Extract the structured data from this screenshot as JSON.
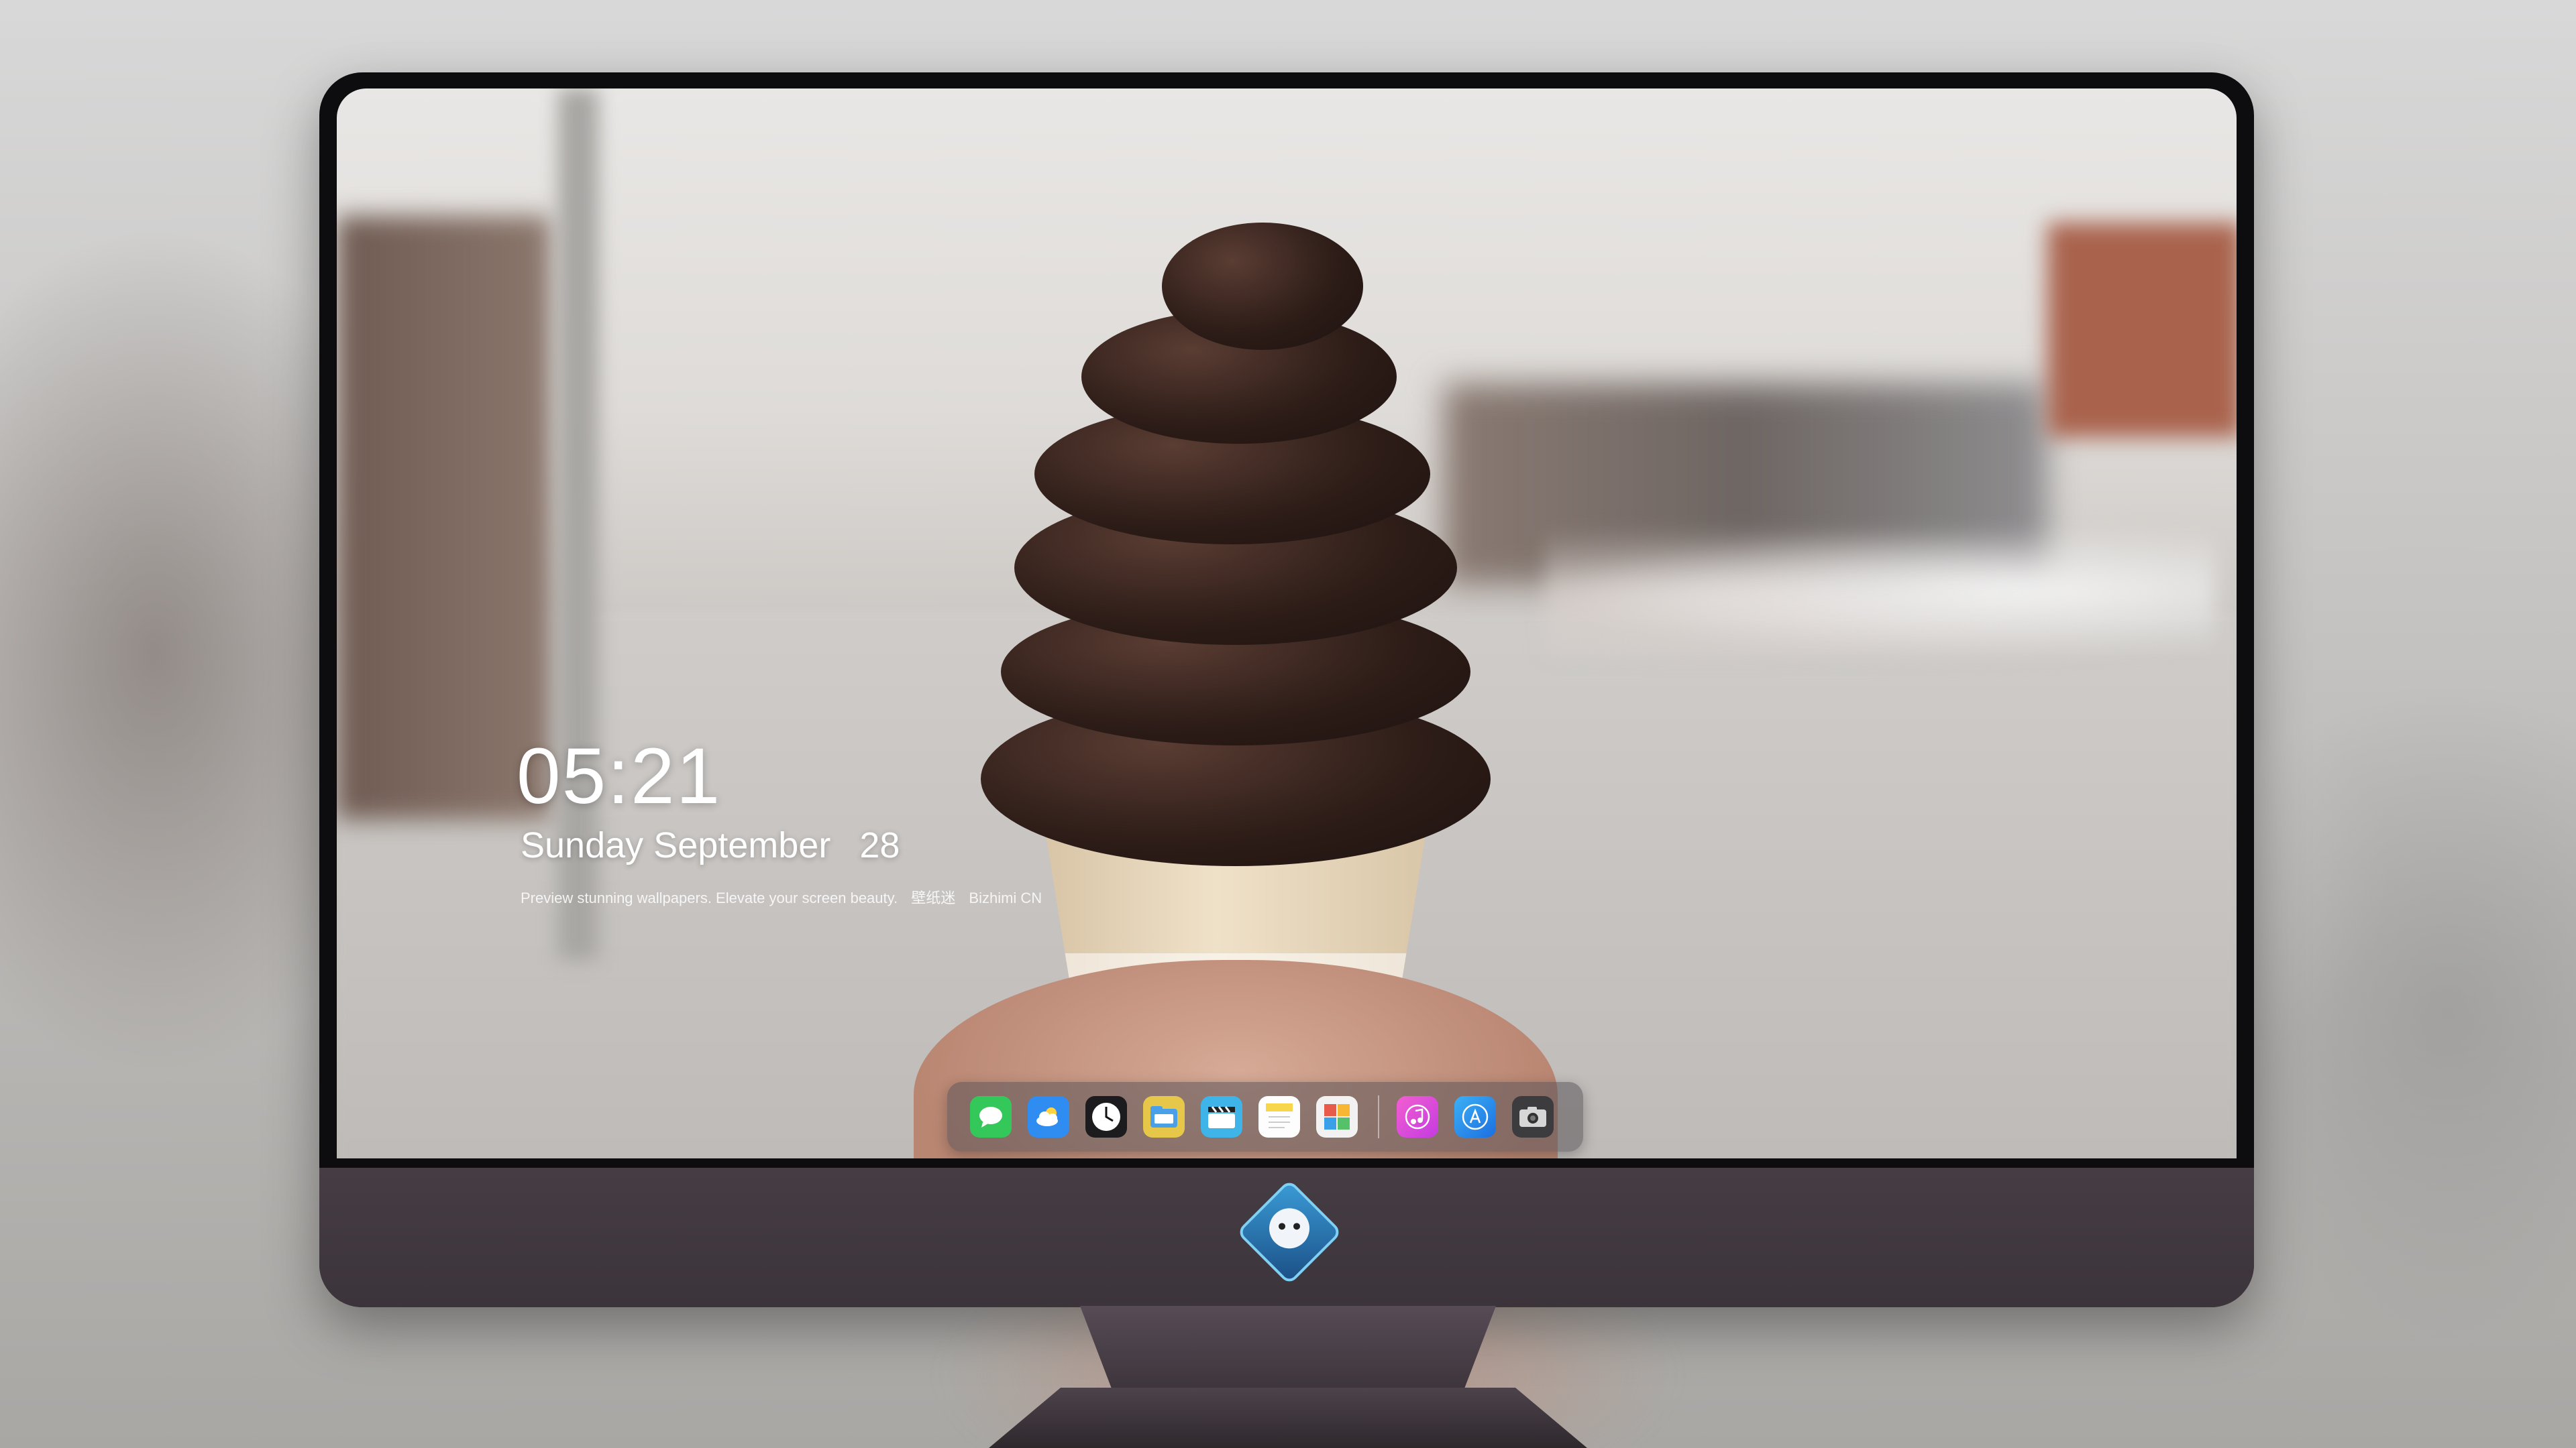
{
  "lockscreen": {
    "time": "05:21",
    "weekday": "Sunday",
    "month": "September",
    "day": "28",
    "tagline": "Preview stunning wallpapers. Elevate your screen beauty.",
    "brand_cn": "壁纸迷",
    "brand": "Bizhimi CN"
  },
  "dock": {
    "apps": [
      {
        "name": "messages",
        "icon": "message-bubble-icon",
        "color": "#34c759"
      },
      {
        "name": "weather",
        "icon": "cloud-icon",
        "color": "#2f8cf1"
      },
      {
        "name": "clock",
        "icon": "clock-icon",
        "color": "#1c1c1e"
      },
      {
        "name": "finder",
        "icon": "folder-icon",
        "color": "#e6c74a"
      },
      {
        "name": "video",
        "icon": "clapperboard-icon",
        "color": "#3fb4e8"
      },
      {
        "name": "notes",
        "icon": "notes-icon",
        "color": "#f7d64b"
      },
      {
        "name": "photos",
        "icon": "photos-icon",
        "color": "#e85b4a"
      },
      {
        "name": "music",
        "icon": "music-note-icon",
        "color": "#e24bd7"
      },
      {
        "name": "app-store",
        "icon": "app-store-icon",
        "color": "#1f8ff0"
      },
      {
        "name": "camera",
        "icon": "camera-icon",
        "color": "#3c3c3e"
      }
    ]
  },
  "colors": {
    "bezel": "#0d0d0f",
    "chin": "#463d44",
    "text": "#ffffff"
  }
}
